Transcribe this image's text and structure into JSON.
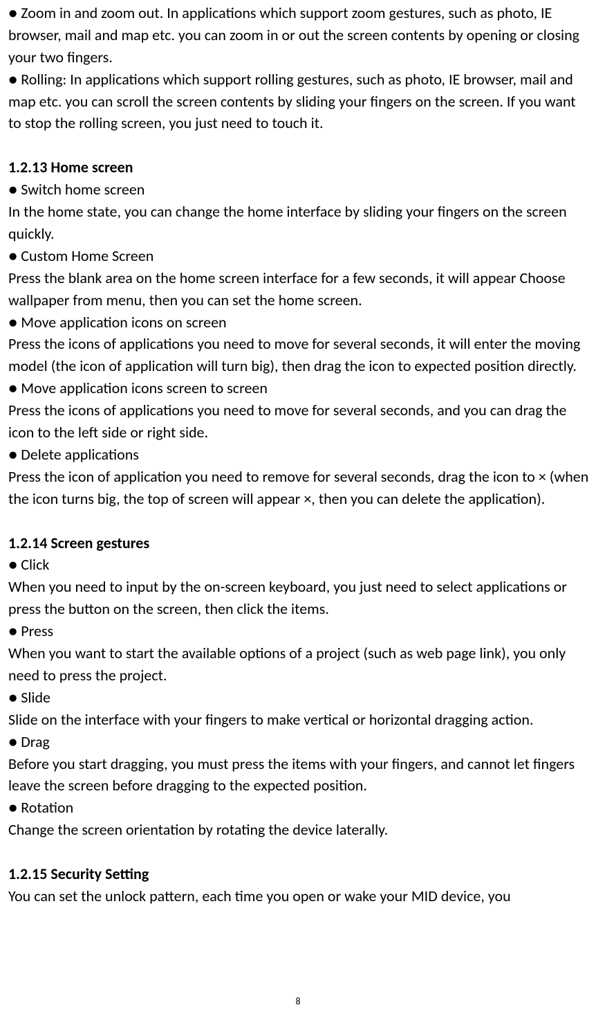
{
  "intro": {
    "zoom": "● Zoom in and zoom out. In applications which support zoom gestures, such as photo, IE browser, mail and map etc. you can zoom in or out the screen contents by opening or closing your two fingers.",
    "rolling": "● Rolling: In applications which support rolling gestures, such as photo, IE browser, mail and map etc. you can scroll the screen contents by sliding your fingers on the screen. If you want to stop the rolling screen, you just need to touch it."
  },
  "sections": {
    "home": {
      "heading": "1.2.13 Home screen",
      "switch_title": "● Switch home screen",
      "switch_body": "In the home state, you can change the home interface by sliding your fingers on the screen quickly.",
      "custom_title": "● Custom Home Screen",
      "custom_body": "Press the blank area on the home screen interface for a few seconds, it will appear Choose wallpaper from menu, then you can set the home screen.",
      "move_on_title": "● Move application icons on screen",
      "move_on_body": "Press the icons of applications you need to move for several seconds, it will enter the moving model (the icon of application will turn big), then drag the icon to expected position directly.",
      "move_s2s_title": "● Move application icons screen to screen",
      "move_s2s_body": "Press the icons of applications you need to move for several seconds, and you can drag the icon to the left side or right side.",
      "delete_title": "● Delete applications",
      "delete_body": "Press the icon of application you need to remove for several seconds, drag the icon to × (when the icon turns big, the top of screen will appear ×, then you can delete the application)."
    },
    "gestures": {
      "heading": "1.2.14 Screen gestures",
      "click_title": "● Click",
      "click_body": "When you need to input by the on-screen keyboard, you just need to select applications or press the button on the screen, then click the items.",
      "press_title": "● Press",
      "press_body": "When you want to start the available options of a project (such as web page link), you only need to press the project.",
      "slide_title": "● Slide",
      "slide_body": "Slide on the interface with your fingers to make vertical or horizontal dragging action.",
      "drag_title": "● Drag",
      "drag_body": "Before you start dragging, you must press the items with your fingers, and cannot let fingers leave the screen before dragging to the expected position.",
      "rotation_title": "● Rotation",
      "rotation_body": "Change the screen orientation by rotating the device laterally."
    },
    "security": {
      "heading": "1.2.15 Security Setting",
      "body": "You can set the unlock pattern, each time you open or wake your MID device, you"
    }
  },
  "page_number": "8"
}
